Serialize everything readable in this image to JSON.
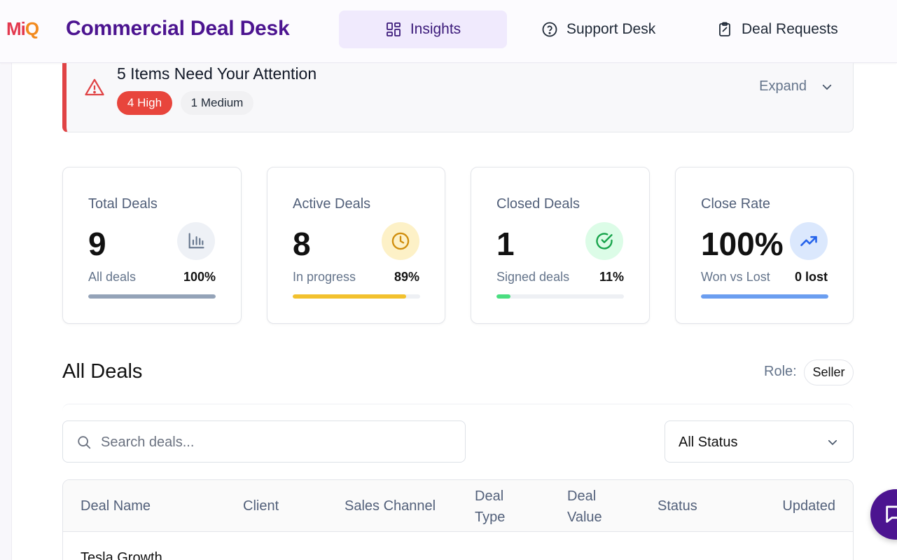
{
  "header": {
    "logo_part1": "Mi",
    "logo_part2": "Q",
    "app_title": "Commercial Deal Desk",
    "tabs": [
      {
        "label": "Insights",
        "icon": "grid-icon",
        "active": true
      },
      {
        "label": "Support Desk",
        "icon": "help-circle-icon",
        "active": false
      },
      {
        "label": "Deal Requests",
        "icon": "clipboard-icon",
        "active": false
      }
    ]
  },
  "attention": {
    "title": "5 Items Need Your Attention",
    "high_badge": "4 High",
    "medium_badge": "1 Medium",
    "expand_label": "Expand",
    "accent_color": "#e04345"
  },
  "stats": {
    "total": {
      "label": "Total Deals",
      "value": "9",
      "sub": "All deals",
      "pct": "100%",
      "fill": 1.0,
      "bar_color": "#94a3b8",
      "icon": "bar-chart-icon"
    },
    "active": {
      "label": "Active Deals",
      "value": "8",
      "sub": "In progress",
      "pct": "89%",
      "fill": 0.89,
      "bar_color": "#f2c12e",
      "icon": "clock-icon"
    },
    "closed": {
      "label": "Closed Deals",
      "value": "1",
      "sub": "Signed deals",
      "pct": "11%",
      "fill": 0.11,
      "bar_color": "#4ade80",
      "icon": "check-circle-icon"
    },
    "rate": {
      "label": "Close Rate",
      "value": "100%",
      "sub": "Won vs Lost",
      "pct": "0 lost",
      "fill": 1.0,
      "bar_color": "#6b9ef0",
      "icon": "trending-up-icon"
    }
  },
  "deals": {
    "title": "All Deals",
    "role_label": "Role:",
    "role_value": "Seller",
    "search_placeholder": "Search deals...",
    "status_filter": "All Status",
    "columns": {
      "name": "Deal Name",
      "client": "Client",
      "channel": "Sales Channel",
      "type": "Deal Type",
      "value": "Deal Value",
      "status": "Status",
      "updated": "Updated"
    },
    "rows": [
      {
        "name": "Tesla Growth"
      }
    ]
  },
  "colors": {
    "brand": "#4c1490",
    "active_tab_bg": "#f0eafd"
  }
}
